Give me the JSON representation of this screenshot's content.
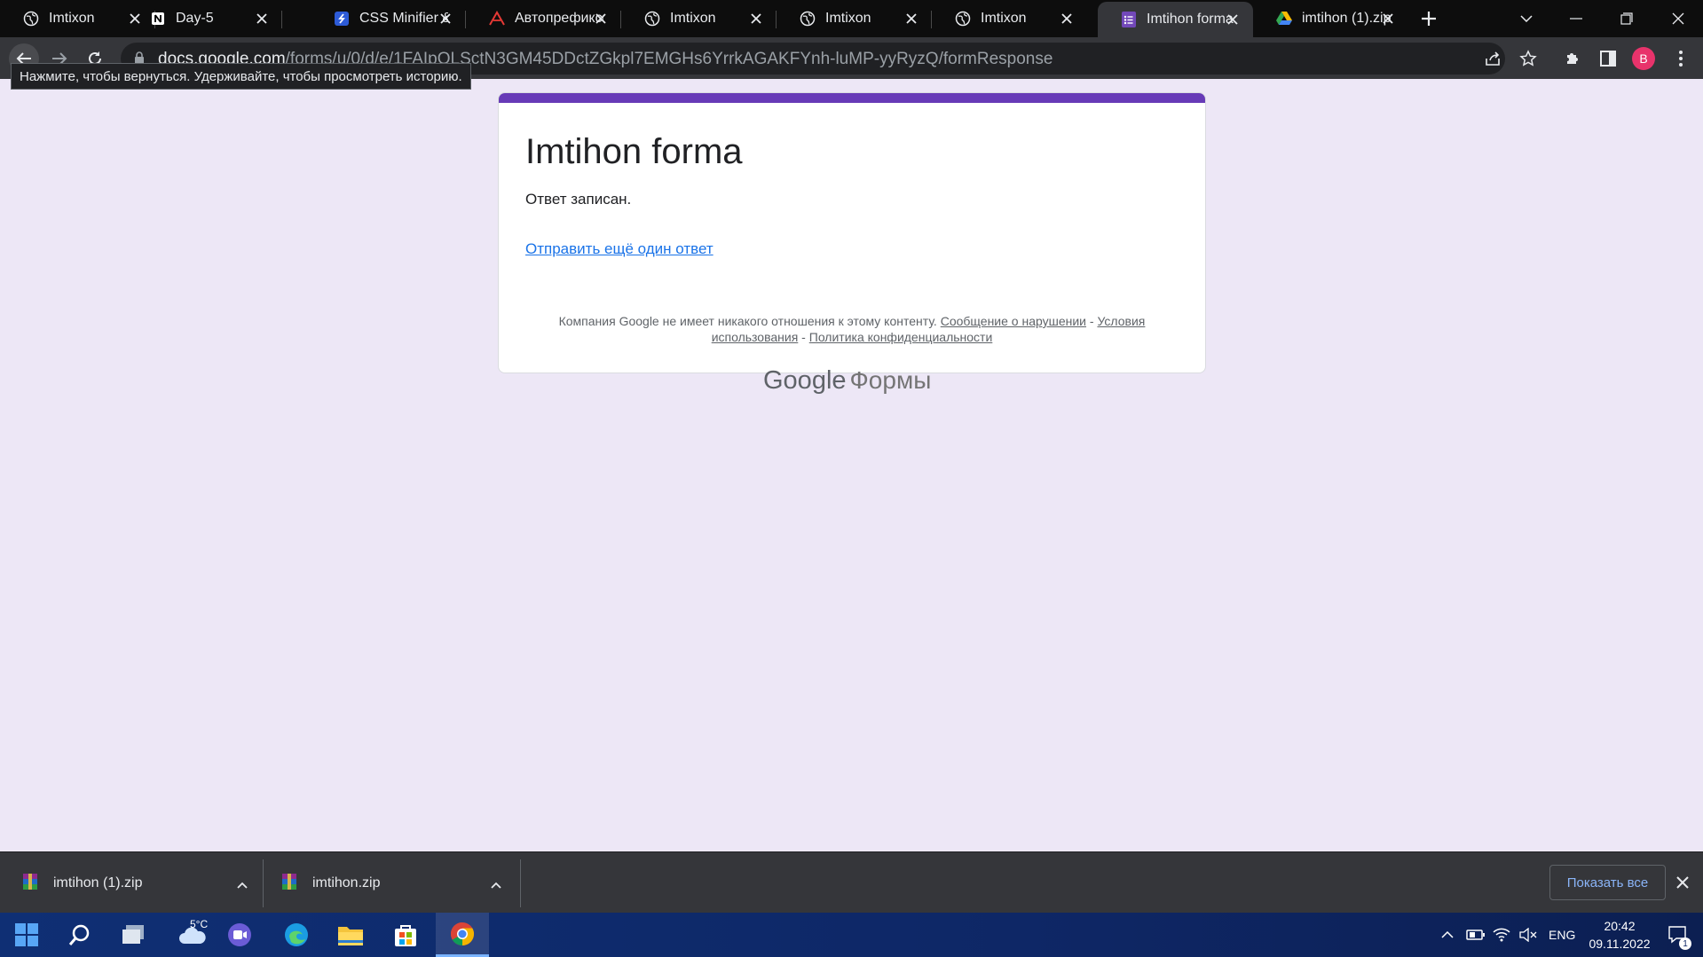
{
  "browser": {
    "tabs": [
      {
        "title": "Imtixon",
        "icon": "globe-icon"
      },
      {
        "title": "Day-5",
        "icon": "notion-icon"
      },
      {
        "title": "CSS Minifier & Compressor",
        "icon": "css-minifier-icon"
      },
      {
        "title": "Автопрефиксер",
        "icon": "autoprefixer-icon"
      },
      {
        "title": "Imtixon",
        "icon": "globe-icon"
      },
      {
        "title": "Imtixon",
        "icon": "globe-icon"
      },
      {
        "title": "Imtixon",
        "icon": "globe-icon"
      },
      {
        "title": "Imtihon forma",
        "icon": "google-forms-icon",
        "active": true
      },
      {
        "title": "imtihon (1).zip",
        "icon": "google-drive-icon"
      }
    ],
    "url_host": "docs.google.com",
    "url_path": "/forms/u/0/d/e/1FAIpQLSctN3GM45DDctZGkpl7EMGHs6YrrkAGAKFYnh-luMP-yyRyzQ/formResponse",
    "back_tooltip": "Нажмите, чтобы вернуться. Удерживайте, чтобы просмотреть историю.",
    "profile_letter": "B",
    "accent_color": "#673ab7"
  },
  "form": {
    "title": "Imtihon forma",
    "message": "Ответ записан.",
    "another_link": "Отправить ещё один ответ"
  },
  "footer": {
    "disclaimer": "Компания Google не имеет никакого отношения к этому контенту.",
    "report_link": "Сообщение о нарушении",
    "terms_link": "Условия использования",
    "privacy_link": "Политика конфиденциальности",
    "separator": " - ",
    "brand_google": "Google",
    "brand_forms": "Формы"
  },
  "downloads": {
    "items": [
      {
        "name": "imtihon (1).zip"
      },
      {
        "name": "imtihon.zip"
      }
    ],
    "show_all": "Показать все"
  },
  "taskbar": {
    "weather": "5°C",
    "language": "ENG",
    "time": "20:42",
    "date": "09.11.2022",
    "notifications": "1"
  }
}
